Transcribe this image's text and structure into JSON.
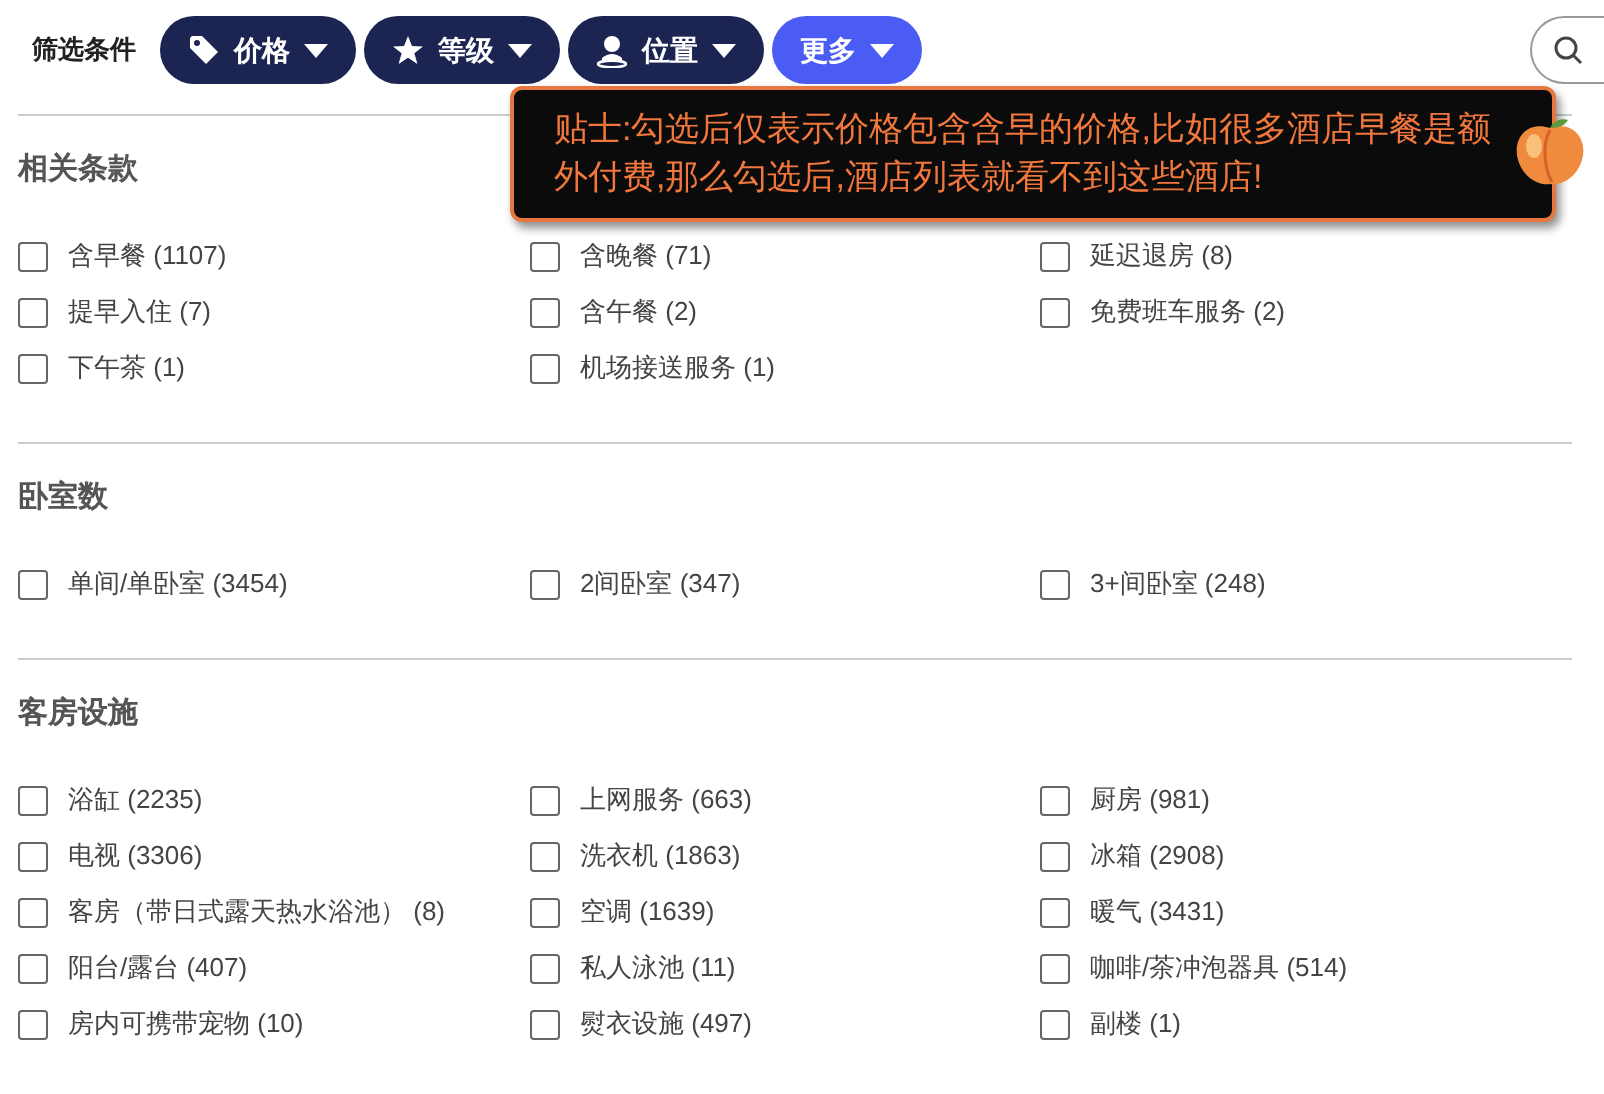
{
  "filter_bar": {
    "label": "筛选条件",
    "filters": [
      {
        "label": "价格",
        "kind": "tag",
        "selected": false
      },
      {
        "label": "等级",
        "kind": "star",
        "selected": false
      },
      {
        "label": "位置",
        "kind": "person",
        "selected": false
      },
      {
        "label": "更多",
        "kind": "plain",
        "selected": true
      }
    ]
  },
  "tooltip": {
    "text": "贴士:勾选后仅表示价格包含含早的价格,比如很多酒店早餐是额外付费,那么勾选后,酒店列表就看不到这些酒店!"
  },
  "sections": [
    {
      "title": "相关条款",
      "options": [
        {
          "label": "含早餐 (1107)",
          "checked": false
        },
        {
          "label": "含晚餐 (71)",
          "checked": false
        },
        {
          "label": "延迟退房 (8)",
          "checked": false
        },
        {
          "label": "提早入住 (7)",
          "checked": false
        },
        {
          "label": "含午餐 (2)",
          "checked": false
        },
        {
          "label": "免费班车服务 (2)",
          "checked": false
        },
        {
          "label": "下午茶 (1)",
          "checked": false
        },
        {
          "label": "机场接送服务 (1)",
          "checked": false
        }
      ]
    },
    {
      "title": "卧室数",
      "options": [
        {
          "label": "单间/单卧室 (3454)",
          "checked": false
        },
        {
          "label": "2间卧室 (347)",
          "checked": false
        },
        {
          "label": "3+间卧室 (248)",
          "checked": false
        }
      ]
    },
    {
      "title": "客房设施",
      "options": [
        {
          "label": "浴缸 (2235)",
          "checked": false
        },
        {
          "label": "上网服务 (663)",
          "checked": false
        },
        {
          "label": "厨房 (981)",
          "checked": false
        },
        {
          "label": "电视 (3306)",
          "checked": false
        },
        {
          "label": "洗衣机 (1863)",
          "checked": false
        },
        {
          "label": "冰箱 (2908)",
          "checked": false
        },
        {
          "label": "客房（带日式露天热水浴池） (8)",
          "checked": false
        },
        {
          "label": "空调 (1639)",
          "checked": false
        },
        {
          "label": "暖气 (3431)",
          "checked": false
        },
        {
          "label": "阳台/露台 (407)",
          "checked": false
        },
        {
          "label": "私人泳池 (11)",
          "checked": false
        },
        {
          "label": "咖啡/茶冲泡器具 (514)",
          "checked": false
        },
        {
          "label": "房内可携带宠物 (10)",
          "checked": false
        },
        {
          "label": "熨衣设施 (497)",
          "checked": false
        },
        {
          "label": "副楼 (1)",
          "checked": false
        }
      ]
    }
  ]
}
